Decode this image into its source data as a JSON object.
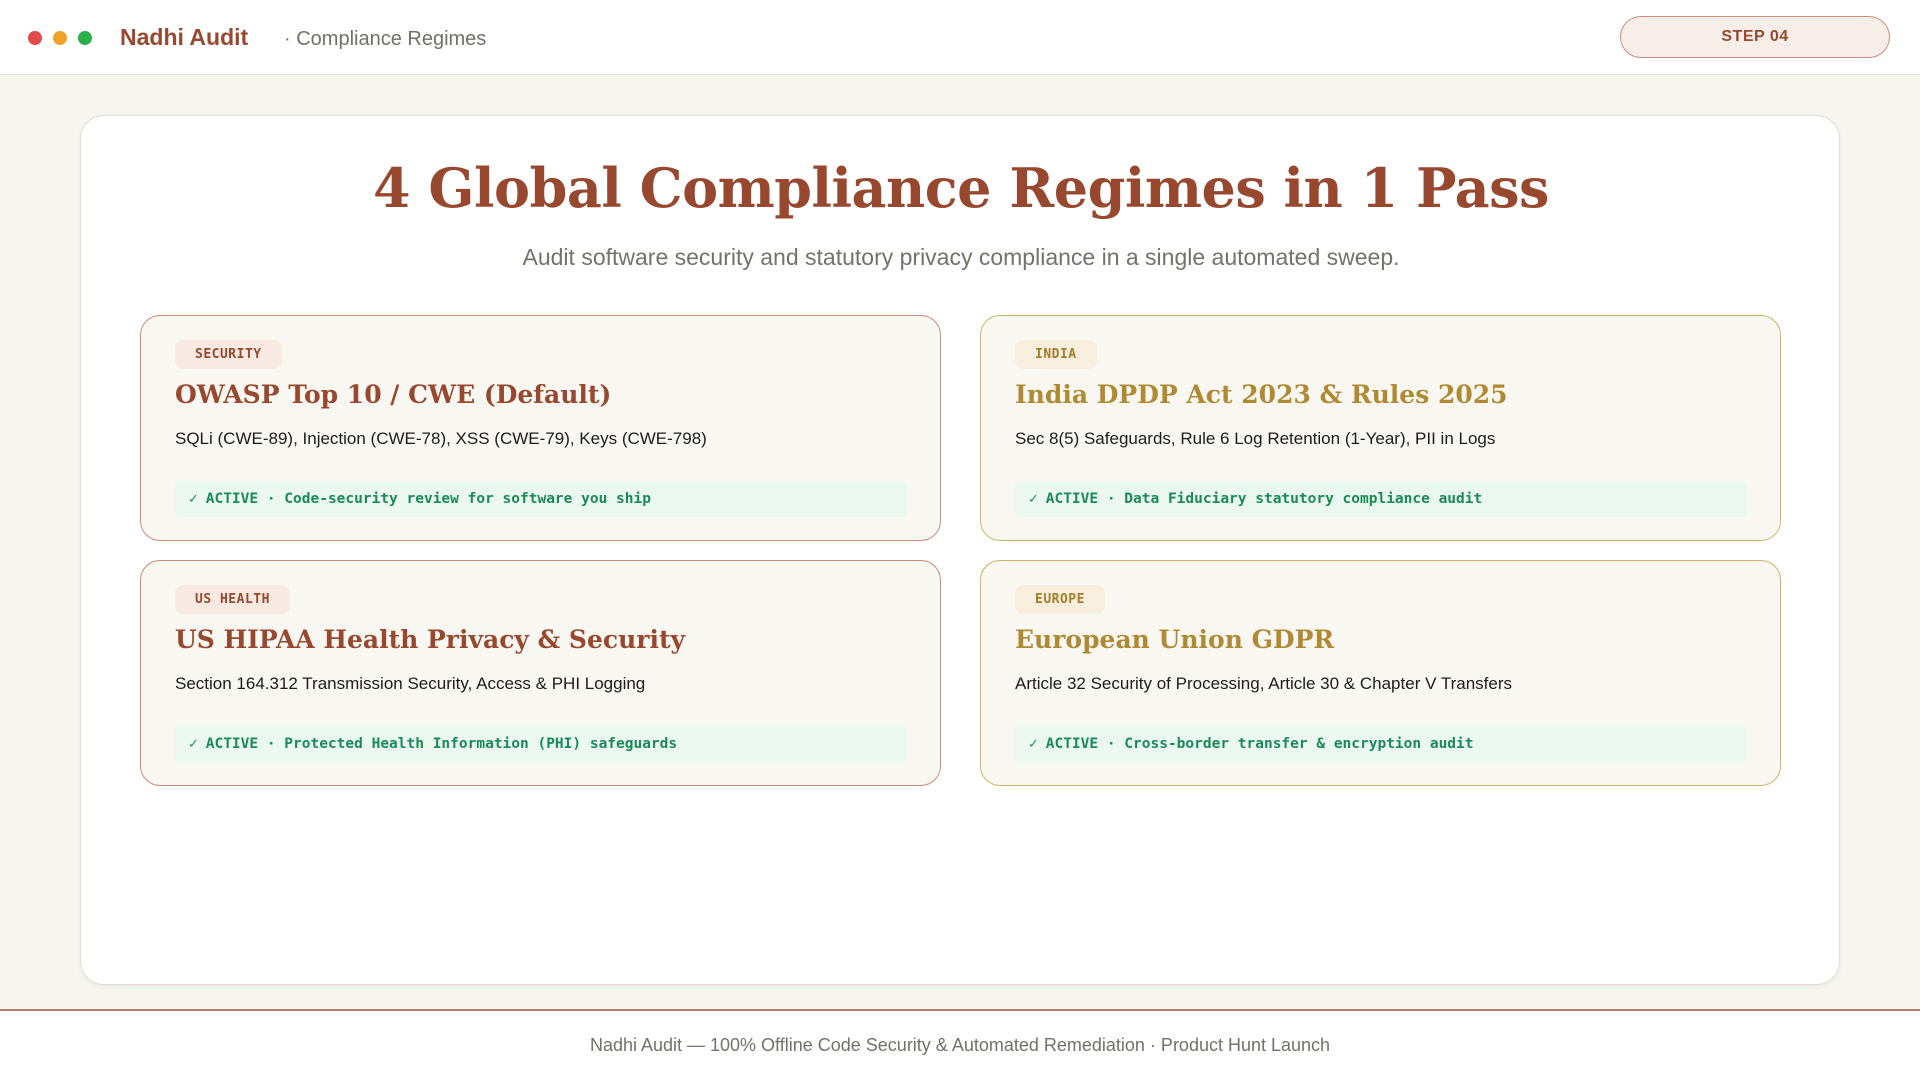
{
  "window": {
    "controls": [
      "close",
      "minimize",
      "maximize"
    ]
  },
  "header": {
    "brand": "Nadhi Audit",
    "breadcrumb": "· Compliance Regimes",
    "step_label": "STEP 04"
  },
  "main": {
    "title": "4 Global Compliance Regimes in 1 Pass",
    "subtitle": "Audit software security and statutory privacy compliance in a single automated sweep.",
    "regimes": [
      {
        "tag": "SECURITY",
        "title": "OWASP Top 10 / CWE (Default)",
        "description": "SQLi (CWE-89), Injection (CWE-78), XSS (CWE-79), Keys (CWE-798)",
        "status_icon": "✓",
        "status": "ACTIVE · Code-security review for software you ship"
      },
      {
        "tag": "INDIA",
        "title": "India DPDP Act 2023 & Rules 2025",
        "description": "Sec 8(5) Safeguards, Rule 6 Log Retention (1-Year), PII in Logs",
        "status_icon": "✓",
        "status": "ACTIVE · Data Fiduciary statutory compliance audit"
      },
      {
        "tag": "US HEALTH",
        "title": "US HIPAA Health Privacy & Security",
        "description": "Section 164.312 Transmission Security, Access & PHI Logging",
        "status_icon": "✓",
        "status": "ACTIVE · Protected Health Information (PHI) safeguards"
      },
      {
        "tag": "EUROPE",
        "title": "European Union GDPR",
        "description": "Article 32 Security of Processing, Article 30 & Chapter V Transfers",
        "status_icon": "✓",
        "status": "ACTIVE · Cross-border transfer & encryption audit"
      }
    ]
  },
  "footer": {
    "text": "Nadhi Audit — 100% Offline Code Security & Automated Remediation · Product Hunt Launch"
  },
  "colors": {
    "brand_rust": "#97482e",
    "gold": "#b08a33",
    "active_green": "#1a8a57",
    "active_bg": "#eaf8ef",
    "background": "#f6f5ef"
  }
}
